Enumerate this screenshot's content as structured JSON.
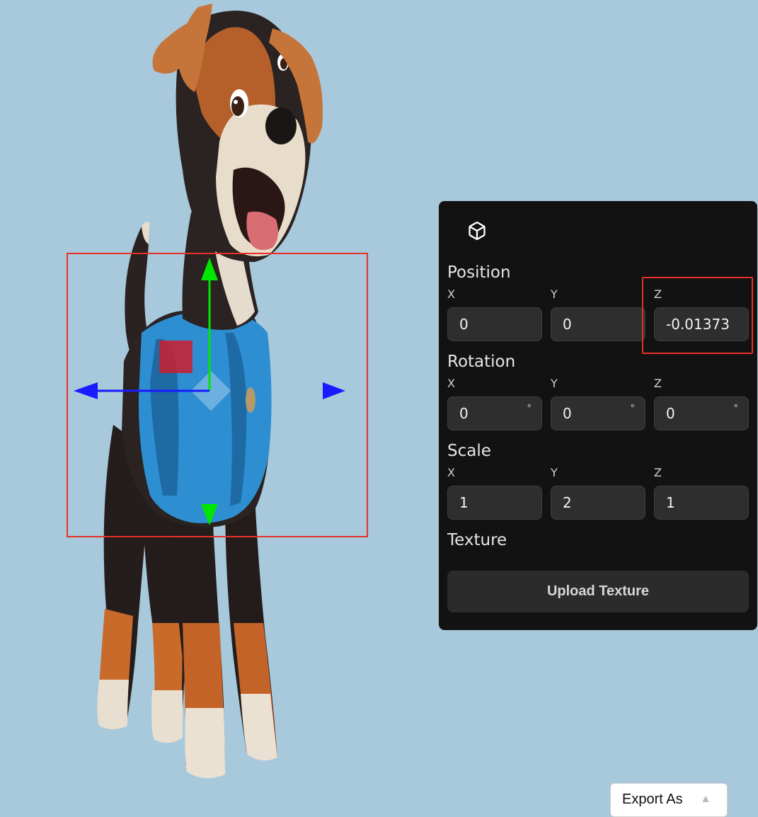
{
  "colors": {
    "background": "#a8c8dc",
    "panel_bg": "#121212",
    "field_bg": "#2e2e2e",
    "highlight": "#e53128",
    "gizmo_y": "#00e600",
    "gizmo_x": "#1a1aff"
  },
  "panel": {
    "icon": "cube-icon",
    "position": {
      "label": "Position",
      "x_label": "X",
      "x_value": "0",
      "y_label": "Y",
      "y_value": "0",
      "z_label": "Z",
      "z_value": "-0.01373"
    },
    "rotation": {
      "label": "Rotation",
      "x_label": "X",
      "x_value": "0",
      "y_label": "Y",
      "y_value": "0",
      "z_label": "Z",
      "z_value": "0",
      "unit": "°"
    },
    "scale": {
      "label": "Scale",
      "x_label": "X",
      "x_value": "1",
      "y_label": "Y",
      "y_value": "2",
      "z_label": "Z",
      "z_value": "1"
    },
    "texture": {
      "label": "Texture",
      "upload_label": "Upload Texture"
    }
  },
  "export": {
    "label": "Export As",
    "icon": "chevron-up-icon"
  }
}
